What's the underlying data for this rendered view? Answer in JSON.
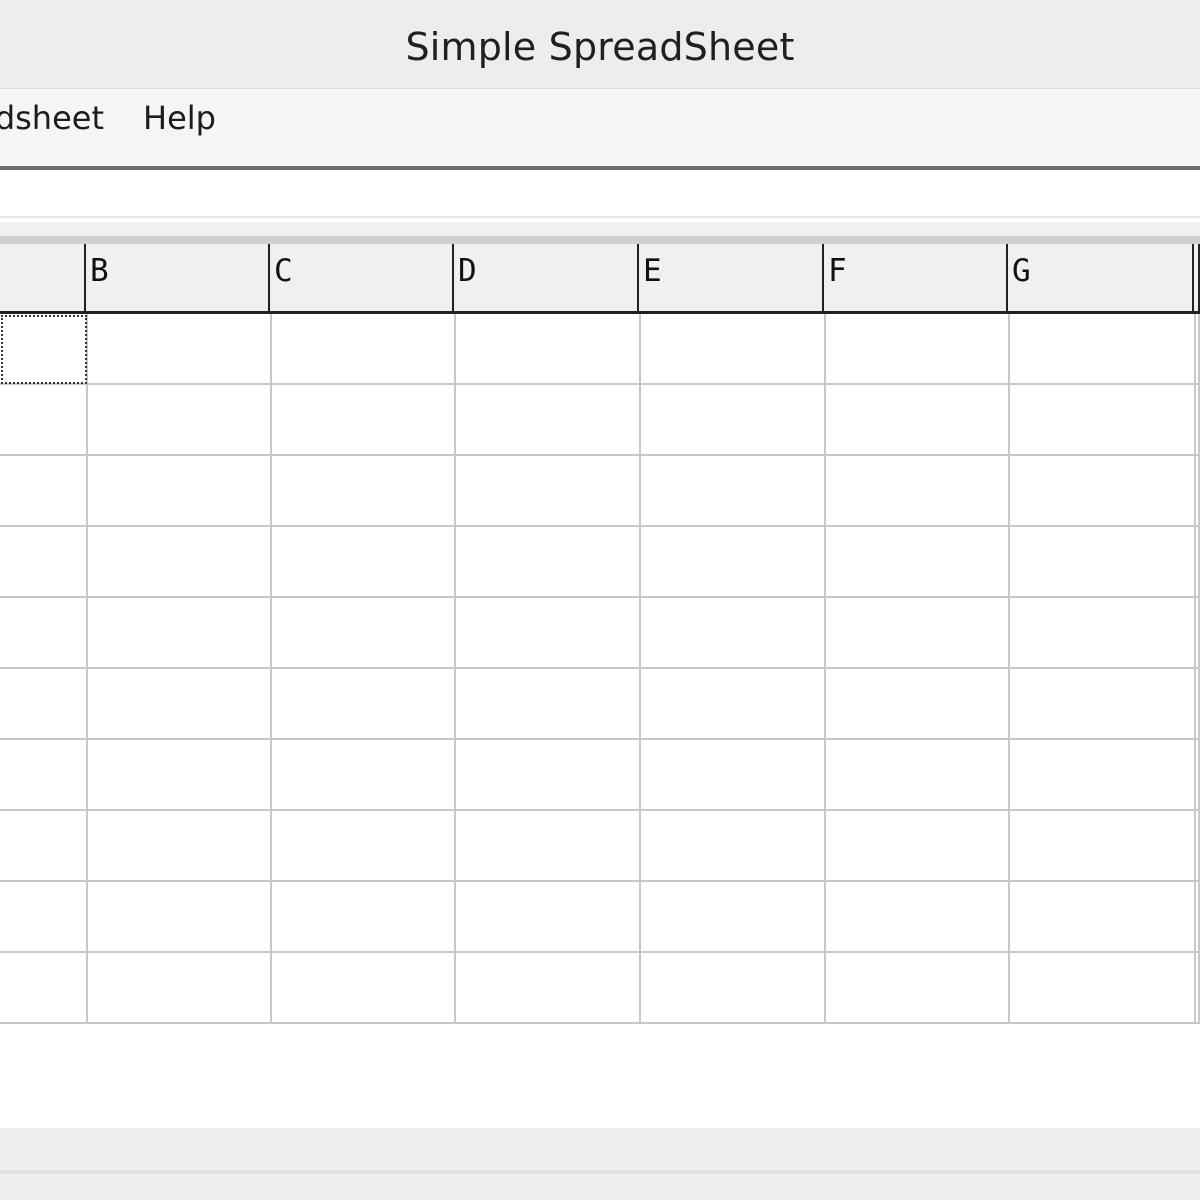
{
  "window": {
    "title": "Simple SpreadSheet"
  },
  "menubar": {
    "items": [
      {
        "id": "spreadsheet",
        "label": "adsheet"
      },
      {
        "id": "help",
        "label": "Help"
      }
    ]
  },
  "formula_bar": {
    "value": ""
  },
  "sheet": {
    "columns": [
      "",
      "B",
      "C",
      "D",
      "E",
      "F",
      "G",
      ""
    ],
    "row_count": 10,
    "selected_cell": {
      "row": 0,
      "col": 0
    }
  }
}
